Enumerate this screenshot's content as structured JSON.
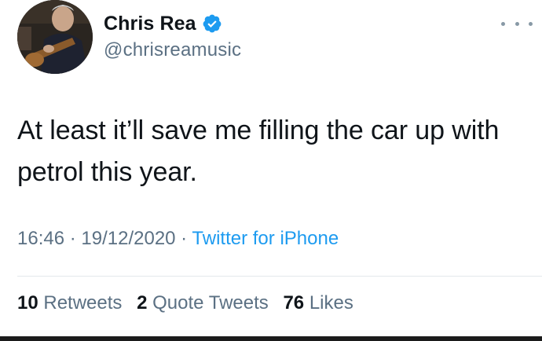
{
  "author": {
    "display_name": "Chris Rea",
    "handle": "@chrisreamusic",
    "verified": true
  },
  "tweet": {
    "text": "At least it’ll save me filling the car up with petrol this year.",
    "time": "16:46",
    "separator": " · ",
    "date": "19/12/2020",
    "source": "Twitter for iPhone"
  },
  "stats": {
    "retweets_count": "10",
    "retweets_label": "Retweets",
    "quote_count": "2",
    "quote_label": "Quote Tweets",
    "likes_count": "76",
    "likes_label": "Likes"
  },
  "colors": {
    "verified": "#1d9bf0",
    "secondary_text": "#5b7083",
    "link": "#1d9bf0"
  },
  "icons": {
    "more": "more-horizontal-icon",
    "verified": "verified-badge-icon"
  }
}
